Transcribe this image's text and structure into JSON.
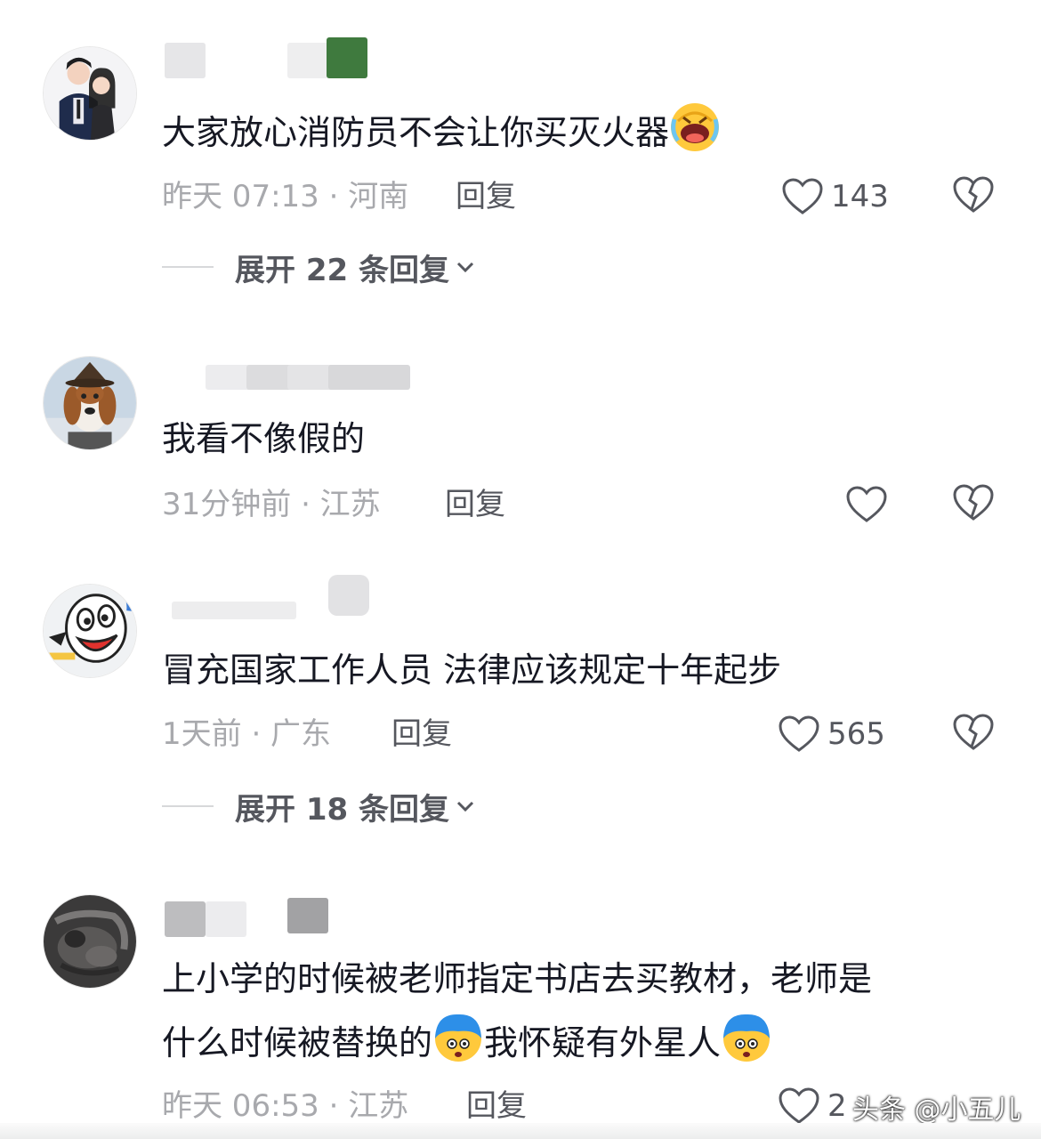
{
  "comments": [
    {
      "text": "大家放心消防员不会让你买灭火器",
      "emoji": "rolling-laughing-emoji",
      "meta": "昨天 07:13 · 河南",
      "reply_label": "回复",
      "likes": "143",
      "expand_label": "展开 22 条回复"
    },
    {
      "text": "我看不像假的",
      "meta": "31分钟前 · 江苏",
      "reply_label": "回复",
      "likes": ""
    },
    {
      "text": "冒充国家工作人员 法律应该规定十年起步",
      "meta": "1天前 · 广东",
      "reply_label": "回复",
      "likes": "565",
      "expand_label": "展开 18 条回复"
    },
    {
      "text_line1": "上小学的时候被老师指定书店去买教材，老师是",
      "text_line2_a": "什么时候被替换的",
      "text_line2_b": "我怀疑有外星人",
      "emoji": "scared-blue-emoji",
      "meta": "昨天 06:53 · 江苏",
      "reply_label": "回复",
      "likes": "2"
    }
  ],
  "watermark": "头条 @小五儿",
  "colors": {
    "primary_text": "#161823",
    "meta_text": "#a8a9ad",
    "secondary_text": "#55575e"
  }
}
